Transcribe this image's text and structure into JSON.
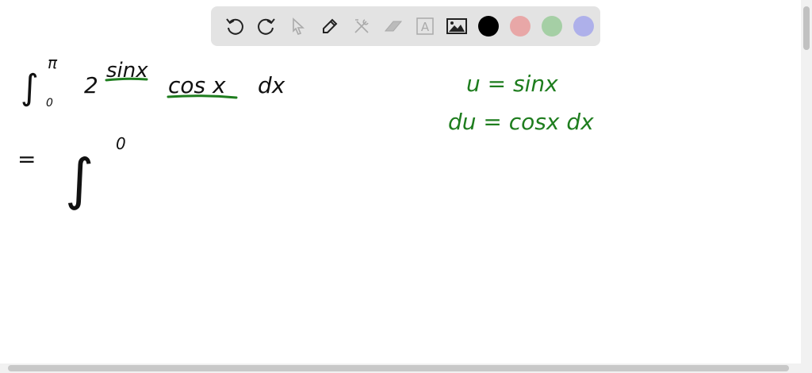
{
  "toolbar": {
    "tools": [
      "undo-icon",
      "redo-icon",
      "select-icon",
      "pen-icon",
      "tools-icon",
      "eraser-icon",
      "text-icon",
      "image-icon"
    ],
    "text_tool_glyph": "A",
    "colors": [
      "#000000",
      "#e8a7a7",
      "#a5cfa5",
      "#aeb0ea"
    ]
  },
  "board": {
    "line1": {
      "integral": "∫",
      "upper": "π",
      "lower": "0",
      "base": "2",
      "exponent": "sinx",
      "factor": "cos x",
      "differential": "dx"
    },
    "line2": {
      "equals": "=",
      "integral": "∫",
      "upper": "0"
    },
    "sub1": "u = sinx",
    "sub2": "du = cosx dx",
    "ink_black": "#111111",
    "ink_green": "#1e7d1e"
  }
}
